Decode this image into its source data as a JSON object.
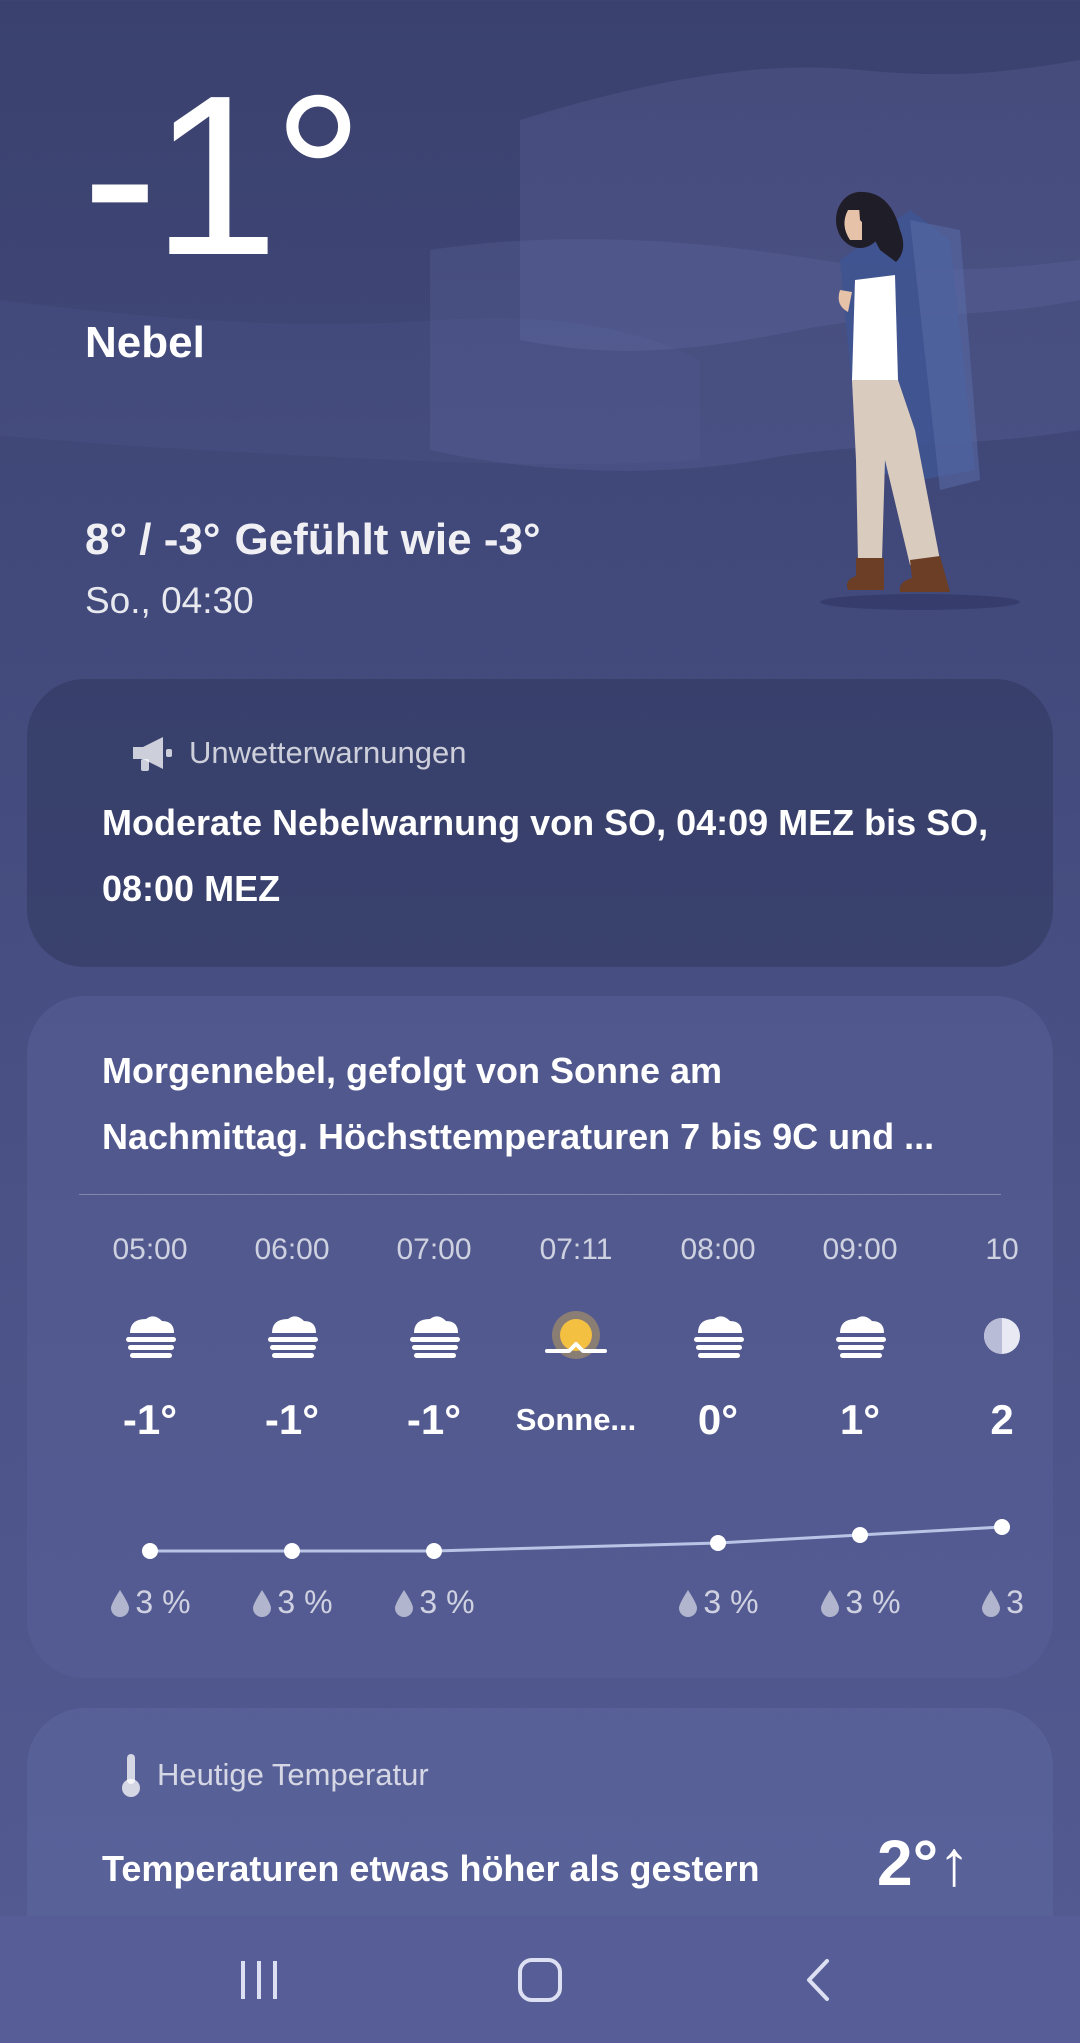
{
  "current": {
    "temperature": "-1°",
    "condition": "Nebel",
    "high_low": "8° / -3°",
    "feels_like": "Gefühlt wie -3°",
    "datetime": "So., 04:30"
  },
  "warnings": {
    "header": "Unwetterwarnungen",
    "text": "Moderate Nebelwarnung von SO, 04:09 MEZ bis SO, 08:00 MEZ",
    "icon": "megaphone-icon"
  },
  "forecast": {
    "summary_line1": "Morgennebel, gefolgt von Sonne am",
    "summary_line2": "Nachmittag. Höchsttemperaturen 7 bis 9C und ...",
    "hours": [
      {
        "time": "05:00",
        "icon": "fog-icon",
        "temp": "-1°",
        "precip": "3 %",
        "temp_value": -1
      },
      {
        "time": "06:00",
        "icon": "fog-icon",
        "temp": "-1°",
        "precip": "3 %",
        "temp_value": -1
      },
      {
        "time": "07:00",
        "icon": "fog-icon",
        "temp": "-1°",
        "precip": "3 %",
        "temp_value": -1
      },
      {
        "time": "07:11",
        "icon": "sunrise-icon",
        "temp": "Sonne...",
        "precip": "",
        "temp_value": null
      },
      {
        "time": "08:00",
        "icon": "fog-icon",
        "temp": "0°",
        "precip": "3 %",
        "temp_value": 0
      },
      {
        "time": "09:00",
        "icon": "fog-icon",
        "temp": "1°",
        "precip": "3 %",
        "temp_value": 1
      },
      {
        "time": "10",
        "icon": "partly-sunny-icon",
        "temp": "2",
        "precip": "3",
        "temp_value": 2
      }
    ]
  },
  "today": {
    "header": "Heutige Temperatur",
    "text": "Temperaturen etwas höher als gestern",
    "delta": "2°↑",
    "icon": "thermometer-icon"
  },
  "colors": {
    "accent_sun": "#f4c041",
    "trend_line": "#b9c3e6"
  }
}
